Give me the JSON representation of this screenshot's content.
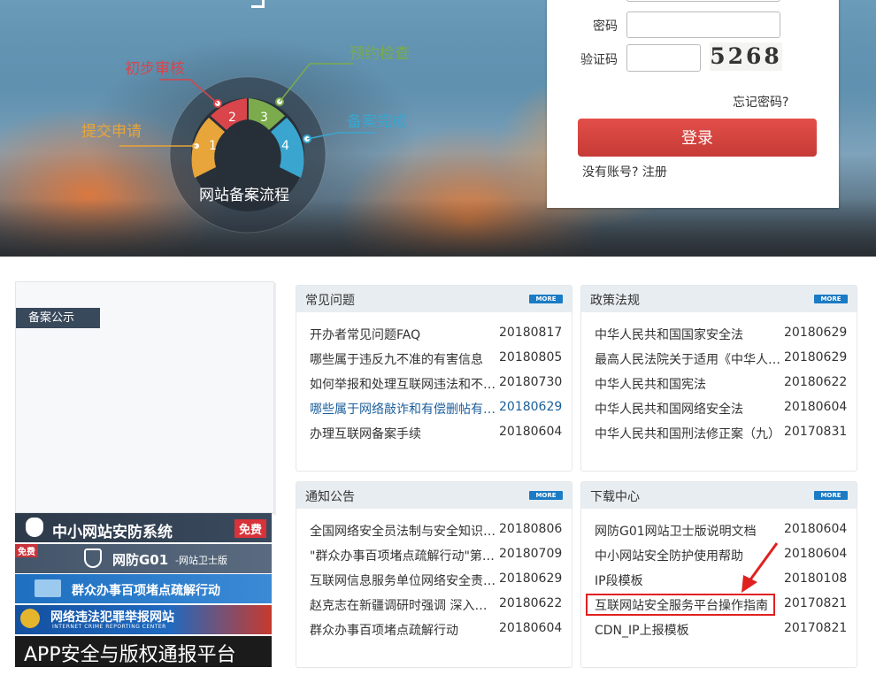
{
  "hero": {
    "process_title": "网站备案流程",
    "steps": [
      {
        "num": "1",
        "label": "提交申请",
        "color": "#e8a53a"
      },
      {
        "num": "2",
        "label": "初步审核",
        "color": "#d8454a"
      },
      {
        "num": "3",
        "label": "预约检查",
        "color": "#7bab4c"
      },
      {
        "num": "4",
        "label": "备案完成",
        "color": "#3aa6cf"
      }
    ]
  },
  "login": {
    "password_label": "密码",
    "captcha_label": "验证码",
    "captcha_text": "5268",
    "forgot": "忘记密码?",
    "login_button": "登录",
    "register": "没有账号? 注册"
  },
  "notice": {
    "tag": "备案公示"
  },
  "banners": {
    "security_system": "中小网站安防系统",
    "free": "免费",
    "free_small": "免费",
    "guard": "网防G01",
    "guard_sub": "-网站卫士版",
    "action": "群众办事百项堵点疏解行动",
    "report": "网络违法犯罪举报网站",
    "report_en": "INTERNET CRIME REPORTING CENTER",
    "app": "APP安全与版权通报平台"
  },
  "more_label": "MORE",
  "panels": {
    "faq": {
      "title": "常见问题",
      "items": [
        {
          "name": "开办者常见问题FAQ",
          "date": "20180817"
        },
        {
          "name": "哪些属于违反九不准的有害信息",
          "date": "20180805"
        },
        {
          "name": "如何举报和处理互联网违法和不良信息",
          "date": "20180730"
        },
        {
          "name": "哪些属于网络敲诈和有偿删帖有关信息",
          "date": "20180629"
        },
        {
          "name": "办理互联网备案手续",
          "date": "20180604"
        }
      ]
    },
    "policy": {
      "title": "政策法规",
      "items": [
        {
          "name": "中华人民共和国国家安全法",
          "date": "20180629"
        },
        {
          "name": "最高人民法院关于适用《中华人民共和国》",
          "date": "20180629"
        },
        {
          "name": "中华人民共和国宪法",
          "date": "20180622"
        },
        {
          "name": "中华人民共和国网络安全法",
          "date": "20180604"
        },
        {
          "name": "中华人民共和国刑法修正案（九）",
          "date": "20170831"
        }
      ]
    },
    "notices": {
      "title": "通知公告",
      "items": [
        {
          "name": "全国网络安全员法制与安全知识竞赛",
          "date": "20180806"
        },
        {
          "name": "\"群众办事百项堵点疏解行动\"第一批",
          "date": "20180709"
        },
        {
          "name": "互联网信息服务单位网络安全责任落实",
          "date": "20180629"
        },
        {
          "name": "赵克志在新疆调研时强调 深入贯彻落实",
          "date": "20180622"
        },
        {
          "name": "群众办事百项堵点疏解行动",
          "date": "20180604"
        }
      ]
    },
    "downloads": {
      "title": "下载中心",
      "items": [
        {
          "name": "网防G01网站卫士版说明文档",
          "date": "20180604"
        },
        {
          "name": "中小网站安全防护使用帮助",
          "date": "20180604"
        },
        {
          "name": "IP段模板",
          "date": "20180108"
        },
        {
          "name": "互联网站安全服务平台操作指南",
          "date": "20170821"
        },
        {
          "name": "CDN_IP上报模板",
          "date": "20170821"
        }
      ]
    }
  }
}
